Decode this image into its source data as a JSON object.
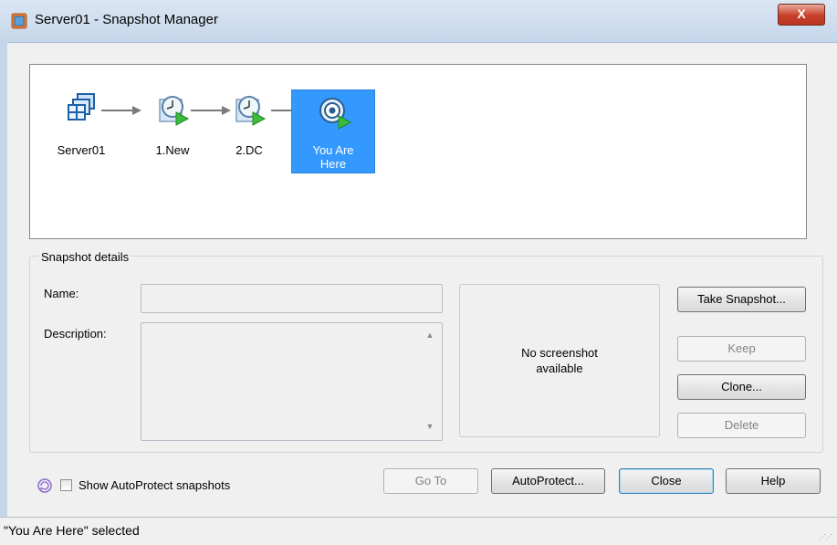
{
  "window": {
    "title": "Server01 - Snapshot Manager",
    "close_glyph": "X"
  },
  "snapshot_tree": {
    "nodes": [
      {
        "label": "Server01",
        "icon": "virtual-machine-icon"
      },
      {
        "label": "1.New",
        "icon": "snapshot-clock-icon"
      },
      {
        "label": "2.DC",
        "icon": "snapshot-clock-icon"
      },
      {
        "label_line1": "You Are",
        "label_line2": "Here",
        "icon": "you-are-here-target-icon",
        "selected": true
      }
    ]
  },
  "details": {
    "legend": "Snapshot details",
    "name_label": "Name:",
    "name_value": "",
    "description_label": "Description:",
    "description_value": "",
    "screenshot_line1": "No screenshot",
    "screenshot_line2": "available"
  },
  "side_buttons": {
    "take_snapshot": "Take Snapshot...",
    "keep": "Keep",
    "clone": "Clone...",
    "delete": "Delete"
  },
  "bottom": {
    "show_autoprotect_label": "Show AutoProtect snapshots",
    "show_autoprotect_checked": false,
    "go_to": "Go To",
    "autoprotect": "AutoProtect...",
    "close": "Close",
    "help": "Help"
  },
  "status": {
    "text": "\"You Are Here\" selected"
  },
  "colors": {
    "selection": "#3399ff",
    "title_gradient_top": "#dbe6f3",
    "close_button": "#c7402b"
  }
}
